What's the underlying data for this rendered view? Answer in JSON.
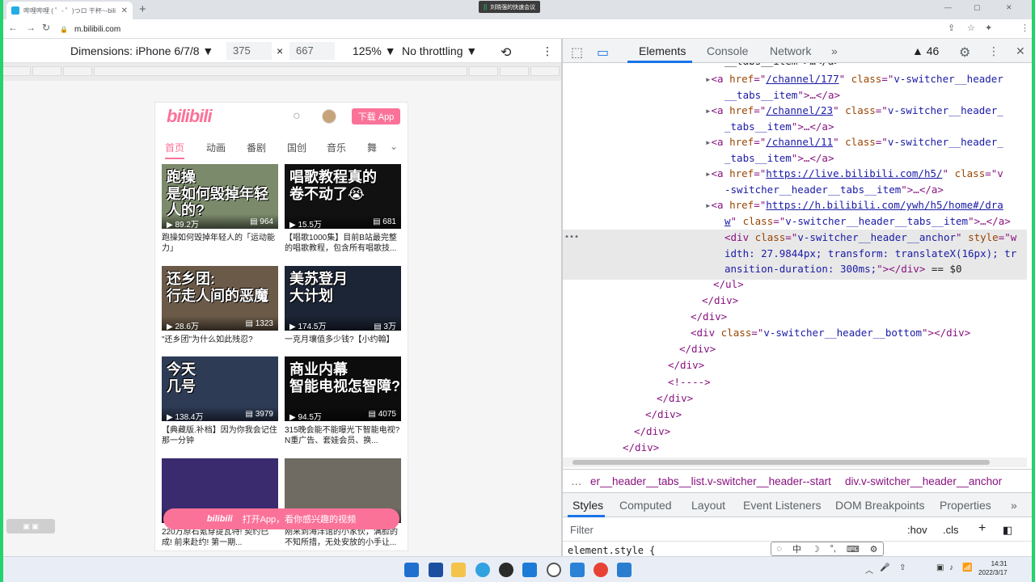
{
  "browser": {
    "tab_title": "哔哩哔哩 ( ゜- ゜)つロ 干杯~-bili",
    "tab_close": "✕",
    "new_tab": "+",
    "meeting_bars": "||",
    "meeting_label": "刘晓强的快速会议",
    "url": "m.bilibili.com",
    "win_min": "—",
    "win_max": "▢",
    "win_close": "✕",
    "back": "←",
    "forward": "→",
    "reload": "↻",
    "lock": "🔒",
    "share": "⇪",
    "star": "☆",
    "ext": "✦",
    "menu": "⋮"
  },
  "device_toolbar": {
    "dimensions_label": "Dimensions: iPhone 6/7/8 ▼",
    "width": "375",
    "times": "×",
    "height": "667",
    "zoom": "125% ▼",
    "throttling": "No throttling ▼",
    "rotate": "⟲",
    "more": "⋮"
  },
  "phone": {
    "logo": "bilibili",
    "search": "○",
    "download_button": "下载 App",
    "tabs": [
      "首页",
      "动画",
      "番剧",
      "国创",
      "音乐",
      "舞"
    ],
    "tabs_more": "⌄",
    "cards": [
      {
        "thumb_text": "跑操\n是如何毁掉年轻人的?",
        "views": "▶ 89.2万",
        "danmaku": "▤ 964",
        "title": "跑操如何毁掉年轻人的「运动能力」",
        "bg": "#7a8a6a"
      },
      {
        "thumb_text": "唱歌教程真的\n卷不动了😭",
        "views": "▶ 15.5万",
        "danmaku": "▤ 681",
        "title": "【唱歌1000集】目前B站最完整的唱歌教程，包含所有唱歌技...",
        "bg": "#111111"
      },
      {
        "thumb_text": "还乡团:\n行走人间的恶魔",
        "views": "▶ 28.6万",
        "danmaku": "▤ 1323",
        "title": "\"还乡团\"为什么如此残忍?",
        "bg": "#6b5a48"
      },
      {
        "thumb_text": "美苏登月\n大计划",
        "views": "▶ 174.5万",
        "danmaku": "▤ 3万",
        "title": "一克月壤值多少钱?【小约翰】",
        "bg": "#1c2536"
      },
      {
        "thumb_text": "今天\n几号",
        "views": "▶ 138.4万",
        "danmaku": "▤ 3979",
        "title": "【典藏版.补档】因为你我会记住那一分钟",
        "bg": "#2d3b55"
      },
      {
        "thumb_text": "商业内幕\n智能电视怎智障?",
        "views": "▶ 94.5万",
        "danmaku": "▤ 4075",
        "title": "315晚会能不能曝光下智能电视? N重广告、套娃会员、换...",
        "bg": "#0d0d0d"
      },
      {
        "thumb_text": "",
        "views": "",
        "danmaku": "",
        "title": "220万原石氪穿提瓦特! 契约已成! 前来赴约! 第一期...",
        "bg": "#3a2a6e"
      },
      {
        "thumb_text": "",
        "views": "",
        "danmaku": "",
        "title": "刚来到海洋馆的小家伙，满脸的不知所措，无处安放的小手让...",
        "bg": "#6f6a62"
      }
    ],
    "open_app_logo": "bilibili",
    "open_app_text": "打开App，看你感兴趣的视频"
  },
  "side_badge": "▣ ▣",
  "devtools": {
    "inspect": "⬚",
    "device": "▭",
    "tabs": [
      "Elements",
      "Console",
      "Network",
      "»"
    ],
    "issues": "▲ 46",
    "settings": "⚙",
    "menu": "⋮",
    "close": "✕",
    "dom": [
      {
        "parts": [
          [
            "plain",
            "__tabs__item\">…</a>"
          ]
        ]
      },
      {
        "parts": [
          [
            "plain",
            "▸"
          ],
          [
            "tag",
            "<a "
          ],
          [
            "attr",
            "href"
          ],
          [
            "tag",
            "=\""
          ],
          [
            "link",
            "/channel/177"
          ],
          [
            "tag",
            "\" "
          ],
          [
            "attr",
            "class"
          ],
          [
            "tag",
            "=\""
          ],
          [
            "val",
            "v-switcher__header"
          ]
        ]
      },
      {
        "parts": [
          [
            "val",
            "__tabs__item"
          ],
          [
            "tag",
            "\">…</a>"
          ]
        ]
      },
      {
        "parts": [
          [
            "plain",
            "▸"
          ],
          [
            "tag",
            "<a "
          ],
          [
            "attr",
            "href"
          ],
          [
            "tag",
            "=\""
          ],
          [
            "link",
            "/channel/23"
          ],
          [
            "tag",
            "\" "
          ],
          [
            "attr",
            "class"
          ],
          [
            "tag",
            "=\""
          ],
          [
            "val",
            "v-switcher__header_"
          ]
        ]
      },
      {
        "parts": [
          [
            "val",
            "_tabs__item"
          ],
          [
            "tag",
            "\">…</a>"
          ]
        ]
      },
      {
        "parts": [
          [
            "plain",
            "▸"
          ],
          [
            "tag",
            "<a "
          ],
          [
            "attr",
            "href"
          ],
          [
            "tag",
            "=\""
          ],
          [
            "link",
            "/channel/11"
          ],
          [
            "tag",
            "\" "
          ],
          [
            "attr",
            "class"
          ],
          [
            "tag",
            "=\""
          ],
          [
            "val",
            "v-switcher__header_"
          ]
        ]
      },
      {
        "parts": [
          [
            "val",
            "_tabs__item"
          ],
          [
            "tag",
            "\">…</a>"
          ]
        ]
      },
      {
        "parts": [
          [
            "plain",
            "▸"
          ],
          [
            "tag",
            "<a "
          ],
          [
            "attr",
            "href"
          ],
          [
            "tag",
            "=\""
          ],
          [
            "link",
            "https://live.bilibili.com/h5/"
          ],
          [
            "tag",
            "\" "
          ],
          [
            "attr",
            "class"
          ],
          [
            "tag",
            "=\"v"
          ]
        ]
      },
      {
        "parts": [
          [
            "val",
            "-switcher__header__tabs__item"
          ],
          [
            "tag",
            "\">…</a>"
          ]
        ]
      },
      {
        "parts": [
          [
            "plain",
            "▸"
          ],
          [
            "tag",
            "<a "
          ],
          [
            "attr",
            "href"
          ],
          [
            "tag",
            "=\""
          ],
          [
            "link",
            "https://h.bilibili.com/ywh/h5/home#/dra"
          ]
        ]
      },
      {
        "parts": [
          [
            "link",
            "w"
          ],
          [
            "tag",
            "\" "
          ],
          [
            "attr",
            "class"
          ],
          [
            "tag",
            "=\""
          ],
          [
            "val",
            "v-switcher__header__tabs__item"
          ],
          [
            "tag",
            "\">…</a>"
          ]
        ]
      },
      {
        "parts": [
          [
            "tag",
            "<div "
          ],
          [
            "attr",
            "class"
          ],
          [
            "tag",
            "=\""
          ],
          [
            "val",
            "v-switcher__header__anchor"
          ],
          [
            "tag",
            "\" "
          ],
          [
            "attr",
            "style"
          ],
          [
            "tag",
            "=\"w"
          ]
        ]
      },
      {
        "parts": [
          [
            "val",
            "idth: 27.9844px; transform: translateX(16px); tr"
          ]
        ]
      },
      {
        "parts": [
          [
            "val",
            "ansition-duration: 300ms;"
          ],
          [
            "tag",
            "\"></div>"
          ],
          [
            "plain",
            " == $0"
          ]
        ]
      },
      {
        "parts": [
          [
            "tag",
            "</ul>"
          ]
        ]
      },
      {
        "parts": [
          [
            "tag",
            "</div>"
          ]
        ]
      },
      {
        "parts": [
          [
            "tag",
            "</div>"
          ]
        ]
      },
      {
        "parts": [
          [
            "tag",
            "<div "
          ],
          [
            "attr",
            "class"
          ],
          [
            "tag",
            "=\""
          ],
          [
            "val",
            "v-switcher__header__bottom"
          ],
          [
            "tag",
            "\"></div>"
          ]
        ]
      },
      {
        "parts": [
          [
            "tag",
            "</div>"
          ]
        ]
      },
      {
        "parts": [
          [
            "tag",
            "</div>"
          ]
        ]
      },
      {
        "parts": [
          [
            "tag",
            "<!---->"
          ]
        ]
      },
      {
        "parts": [
          [
            "tag",
            "</div>"
          ]
        ]
      },
      {
        "parts": [
          [
            "tag",
            "</div>"
          ]
        ]
      },
      {
        "parts": [
          [
            "tag",
            "</div>"
          ]
        ]
      },
      {
        "parts": [
          [
            "tag",
            "</div>"
          ]
        ]
      }
    ],
    "dom_dots": "•••",
    "breadcrumbs_dots": "…",
    "breadcrumb_1": "er__header__tabs__list.v-switcher__header--start",
    "breadcrumb_2": "div.v-switcher__header__anchor",
    "style_tabs": [
      "Styles",
      "Computed",
      "Layout",
      "Event Listeners",
      "DOM Breakpoints",
      "Properties",
      "»"
    ],
    "filter_placeholder": "Filter",
    "hov": ":hov",
    "cls": ".cls",
    "plus": "+",
    "toggle": "◧",
    "element_style": "element.style {",
    "ime": [
      "◌",
      "中",
      "☽",
      "°,",
      "⌨",
      "⚙"
    ]
  },
  "taskbar": {
    "time": "14:31",
    "date": "2022/3/17",
    "tray_up": "︿",
    "tray_icons": [
      "🎤",
      "⇧",
      "▣",
      "♪",
      "📶"
    ]
  }
}
